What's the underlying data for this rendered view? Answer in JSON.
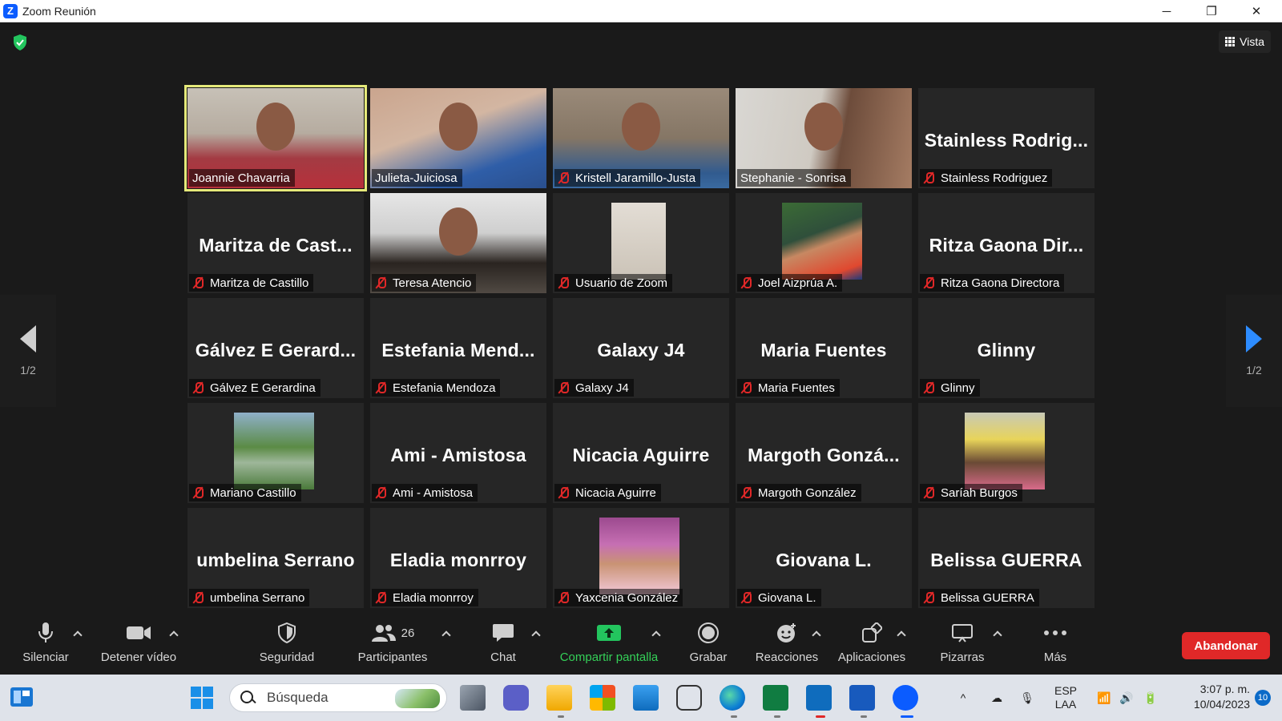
{
  "window": {
    "title": "Zoom Reunión",
    "minimize": "─",
    "restore": "❐",
    "close": "✕"
  },
  "header": {
    "view_label": "Vista"
  },
  "pagination": {
    "left": "1/2",
    "right": "1/2"
  },
  "participants": [
    {
      "name": "Joannie Chavarria",
      "muted": false,
      "video": "v1",
      "active": true
    },
    {
      "name": "Julieta-Juiciosa",
      "muted": false,
      "video": "v2"
    },
    {
      "name": "Kristell Jaramillo-Justa",
      "muted": true,
      "video": "v3"
    },
    {
      "name": "Stephanie - Sonrisa",
      "muted": false,
      "video": "v4"
    },
    {
      "name": "Stainless Rodriguez",
      "display": "Stainless  Rodrig...",
      "muted": true
    },
    {
      "name": "Maritza de Castillo",
      "display": "Maritza de Cast...",
      "muted": true
    },
    {
      "name": "Teresa Atencio",
      "muted": true,
      "video": "v5"
    },
    {
      "name": "Usuario de Zoom",
      "muted": true,
      "avatar": "av-tile"
    },
    {
      "name": "Joel Aizprúa A.",
      "muted": true,
      "avatar": "av-joel"
    },
    {
      "name": "Ritza Gaona Directora",
      "display": "Ritza Gaona Dir...",
      "muted": true
    },
    {
      "name": "Gálvez E Gerardina",
      "display": "Gálvez  E Gerard...",
      "muted": true
    },
    {
      "name": "Estefania Mendoza",
      "display": "Estefania  Mend...",
      "muted": true
    },
    {
      "name": "Galaxy J4",
      "display": "Galaxy J4",
      "muted": true
    },
    {
      "name": "Maria Fuentes",
      "display": "Maria Fuentes",
      "muted": true
    },
    {
      "name": "Glinny",
      "display": "Glinny",
      "muted": true
    },
    {
      "name": "Mariano Castillo",
      "muted": true,
      "avatar": "av-mariano"
    },
    {
      "name": "Ami - Amistosa",
      "display": "Ami - Amistosa",
      "muted": true
    },
    {
      "name": "Nicacia Aguirre",
      "display": "Nicacia Aguirre",
      "muted": true
    },
    {
      "name": "Margoth González",
      "display": "Margoth  Gonzá...",
      "muted": true
    },
    {
      "name": "Saríah Burgos",
      "muted": true,
      "avatar": "av-sariah"
    },
    {
      "name": "umbelina Serrano",
      "display": "umbelina Serrano",
      "muted": true
    },
    {
      "name": "Eladia monrroy",
      "display": "Eladia monrroy",
      "muted": true
    },
    {
      "name": "Yaxcenia González",
      "muted": true,
      "avatar": "av-yaxcenia"
    },
    {
      "name": "Giovana L.",
      "display": "Giovana L.",
      "muted": true
    },
    {
      "name": "Belissa GUERRA",
      "display": "Belissa GUERRA",
      "muted": true
    }
  ],
  "toolbar": {
    "mute": "Silenciar",
    "stop_video": "Detener vídeo",
    "security": "Seguridad",
    "participants": "Participantes",
    "participant_count": "26",
    "chat": "Chat",
    "share": "Compartir pantalla",
    "record": "Grabar",
    "reactions": "Reacciones",
    "apps": "Aplicaciones",
    "whiteboards": "Pizarras",
    "more": "Más",
    "leave": "Abandonar"
  },
  "taskbar": {
    "search_placeholder": "Búsqueda",
    "language": "ESP",
    "layout": "LAA",
    "time": "3:07 p. m.",
    "date": "10/04/2023",
    "notifications": "10"
  },
  "colors": {
    "accent": "#2d8cff",
    "leave": "#e02828",
    "share": "#34d058",
    "active_border": "#e5e97a",
    "muted": "#e02828"
  }
}
